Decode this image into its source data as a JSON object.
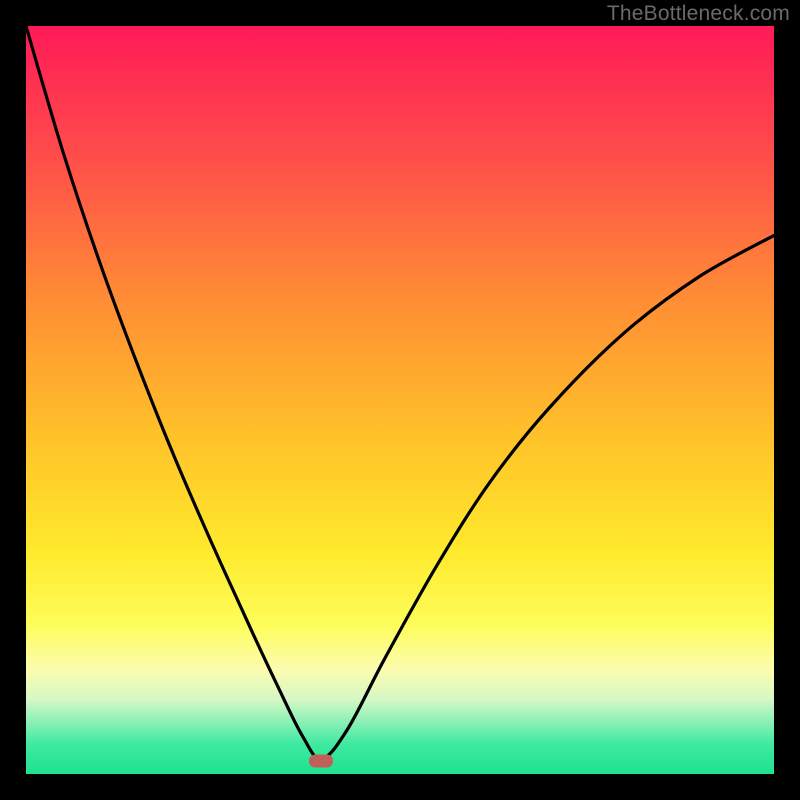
{
  "watermark": "TheBottleneck.com",
  "marker": {
    "x_frac": 0.395,
    "y_frac": 0.982
  },
  "chart_data": {
    "type": "line",
    "title": "",
    "xlabel": "",
    "ylabel": "",
    "xlim": [
      0,
      1
    ],
    "ylim": [
      0,
      1
    ],
    "series": [
      {
        "name": "curve",
        "x": [
          0.0,
          0.05,
          0.1,
          0.15,
          0.2,
          0.25,
          0.3,
          0.34,
          0.37,
          0.395,
          0.43,
          0.48,
          0.55,
          0.62,
          0.7,
          0.8,
          0.9,
          1.0
        ],
        "y": [
          1.0,
          0.83,
          0.68,
          0.545,
          0.42,
          0.305,
          0.195,
          0.11,
          0.05,
          0.02,
          0.06,
          0.155,
          0.28,
          0.39,
          0.49,
          0.59,
          0.665,
          0.72
        ]
      }
    ],
    "gradient_stops": [
      {
        "pos": 0.0,
        "color": "#ff1a58"
      },
      {
        "pos": 0.18,
        "color": "#ff4f4a"
      },
      {
        "pos": 0.36,
        "color": "#ff8b35"
      },
      {
        "pos": 0.55,
        "color": "#ffc229"
      },
      {
        "pos": 0.7,
        "color": "#ffe92c"
      },
      {
        "pos": 0.8,
        "color": "#fdfd5a"
      },
      {
        "pos": 0.86,
        "color": "#fcfcb0"
      },
      {
        "pos": 0.9,
        "color": "#d6f8c5"
      },
      {
        "pos": 0.93,
        "color": "#8cf0b6"
      },
      {
        "pos": 0.96,
        "color": "#3fe9a1"
      },
      {
        "pos": 1.0,
        "color": "#1de28e"
      }
    ]
  }
}
